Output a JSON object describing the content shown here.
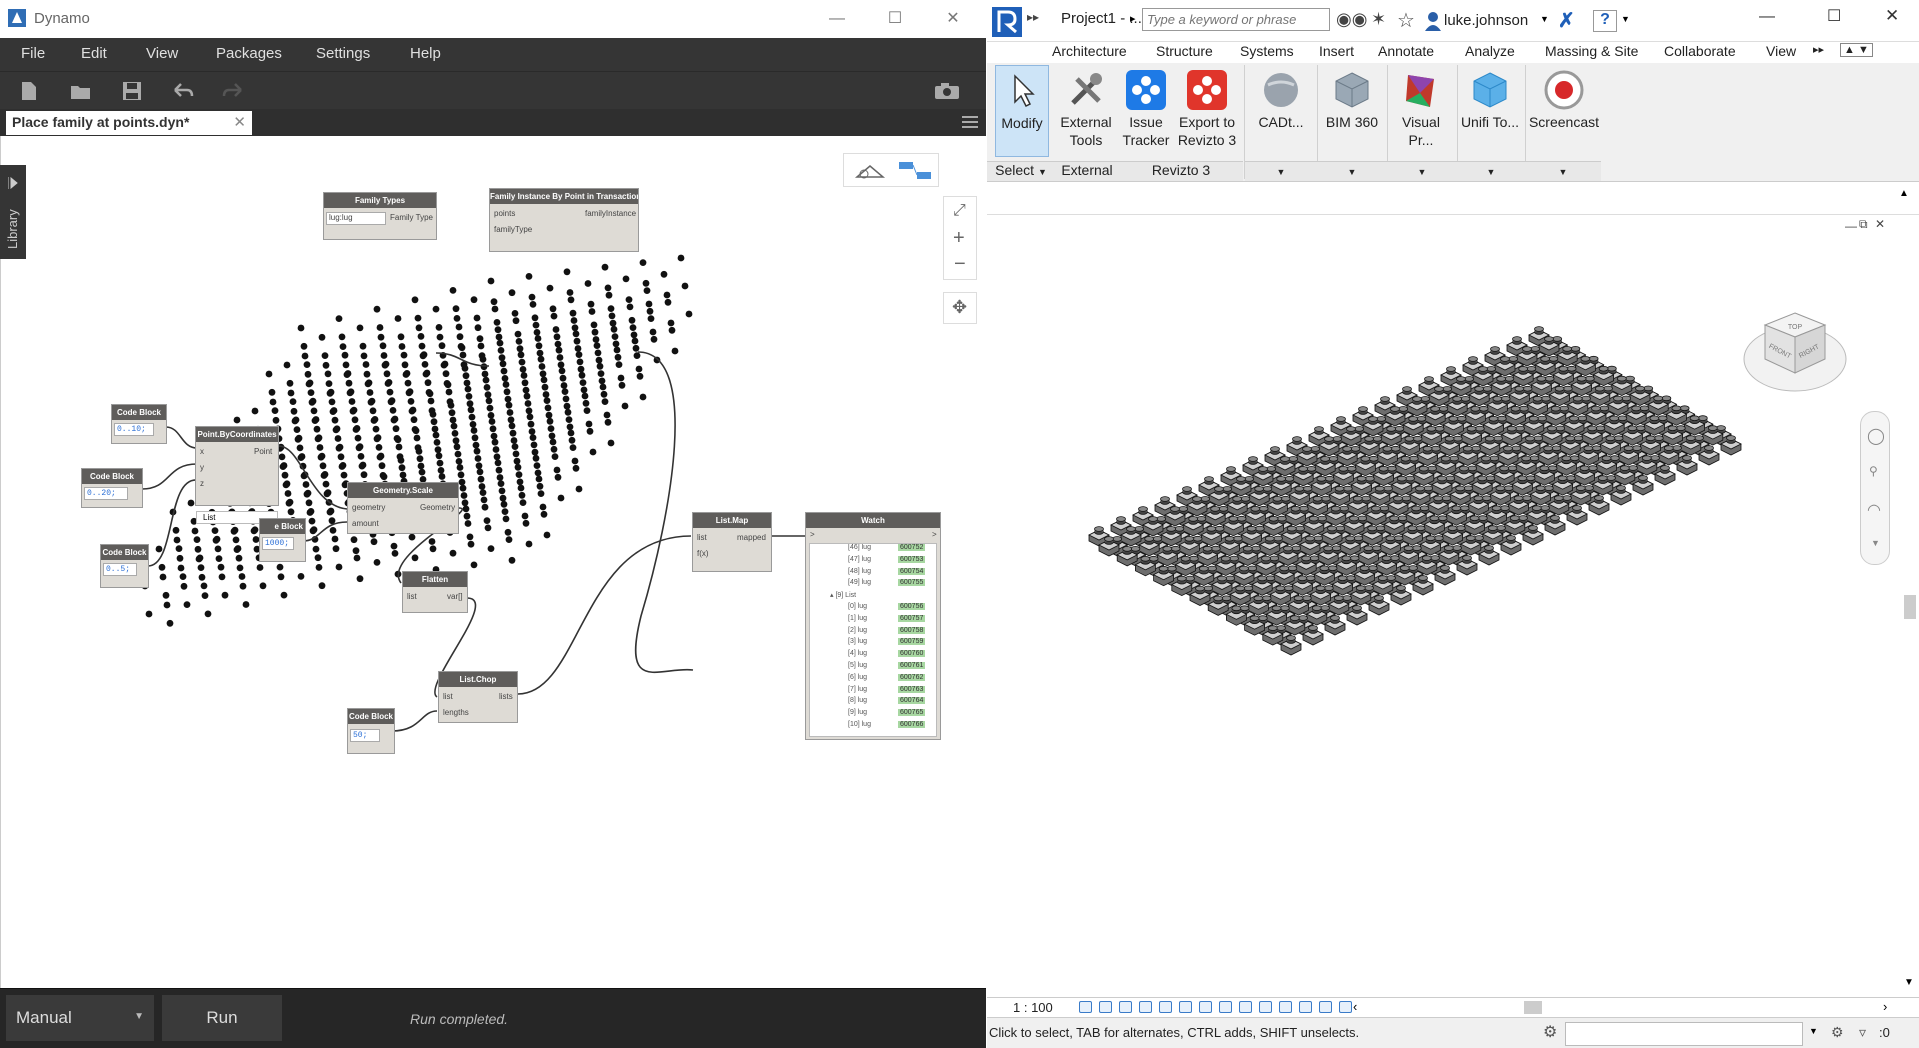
{
  "dynamo": {
    "title": "Dynamo",
    "menu": [
      "File",
      "Edit",
      "View",
      "Packages",
      "Settings",
      "Help"
    ],
    "tab": "Place family at points.dyn*",
    "library": "Library",
    "nodes": {
      "family_types": {
        "title": "Family Types",
        "value": "lug:lug",
        "out": "Family Type"
      },
      "family_instance": {
        "title": "Family Instance By Point in Transaction",
        "in1": "points",
        "in2": "familyType",
        "out": "familyInstance"
      },
      "cb1": {
        "title": "Code Block",
        "code": "0..10;"
      },
      "cb2": {
        "title": "Code Block",
        "code": "0..20;"
      },
      "cb3": {
        "title": "Code Block",
        "code": "0..5;"
      },
      "point": {
        "title": "Point.ByCoordinates",
        "x": "x",
        "y": "y",
        "z": "z",
        "out": "Point",
        "lacing": "List"
      },
      "cb4": {
        "title": "Code Block",
        "code": "1000;",
        "label": "e Block"
      },
      "scale": {
        "title": "Geometry.Scale",
        "in1": "geometry",
        "in2": "amount",
        "out": "Geometry"
      },
      "flatten": {
        "title": "Flatten",
        "in": "list",
        "out": "var[]"
      },
      "chop": {
        "title": "List.Chop",
        "in1": "list",
        "in2": "lengths",
        "out": "lists"
      },
      "cb5": {
        "title": "Code Block",
        "code": "50;"
      },
      "map": {
        "title": "List.Map",
        "in1": "list",
        "in2": "f(x)",
        "out": "mapped"
      },
      "watch": {
        "title": "Watch",
        "in": ">",
        "out": ">",
        "rows": [
          {
            "i": "[46] lug",
            "v": "600752"
          },
          {
            "i": "[47] lug",
            "v": "600753"
          },
          {
            "i": "[48] lug",
            "v": "600754"
          },
          {
            "i": "[49] lug",
            "v": "600755"
          },
          {
            "i": "▴ [9] List",
            "v": ""
          },
          {
            "i": "[0] lug",
            "v": "600756"
          },
          {
            "i": "[1] lug",
            "v": "600757"
          },
          {
            "i": "[2] lug",
            "v": "600758"
          },
          {
            "i": "[3] lug",
            "v": "600759"
          },
          {
            "i": "[4] lug",
            "v": "600760"
          },
          {
            "i": "[5] lug",
            "v": "600761"
          },
          {
            "i": "[6] lug",
            "v": "600762"
          },
          {
            "i": "[7] lug",
            "v": "600763"
          },
          {
            "i": "[8] lug",
            "v": "600764"
          },
          {
            "i": "[9] lug",
            "v": "600765"
          },
          {
            "i": "[10] lug",
            "v": "600766"
          }
        ]
      }
    },
    "run_mode": "Manual",
    "run_button": "Run",
    "run_status": "Run completed."
  },
  "revit": {
    "project": "Project1 - ...",
    "search_placeholder": "Type a keyword or phrase",
    "user": "luke.johnson",
    "tabs": [
      "Architecture",
      "Structure",
      "Systems",
      "Insert",
      "Annotate",
      "Analyze",
      "Massing & Site",
      "Collaborate",
      "View"
    ],
    "buttons": [
      {
        "l1": "Modify",
        "l2": ""
      },
      {
        "l1": "External",
        "l2": "Tools"
      },
      {
        "l1": "Issue",
        "l2": "Tracker"
      },
      {
        "l1": "Export to",
        "l2": "Revizto 3"
      },
      {
        "l1": "CADt...",
        "l2": ""
      },
      {
        "l1": "BIM 360",
        "l2": ""
      },
      {
        "l1": "Visual Pr...",
        "l2": ""
      },
      {
        "l1": "Unifi To...",
        "l2": ""
      },
      {
        "l1": "Screencast",
        "l2": ""
      }
    ],
    "panels": [
      "Select",
      "External",
      "Revizto 3"
    ],
    "viewcube": {
      "top": "TOP",
      "front": "FRONT",
      "right": "RIGHT"
    },
    "scale": "1 : 100",
    "status": "Click to select, TAB for alternates, CTRL adds, SHIFT unselects.",
    "selection_count": ":0",
    "colors": {
      "accent": "#1f5fb8",
      "menu_bg": "#353535",
      "watch_value": "#a7d7a1"
    }
  }
}
